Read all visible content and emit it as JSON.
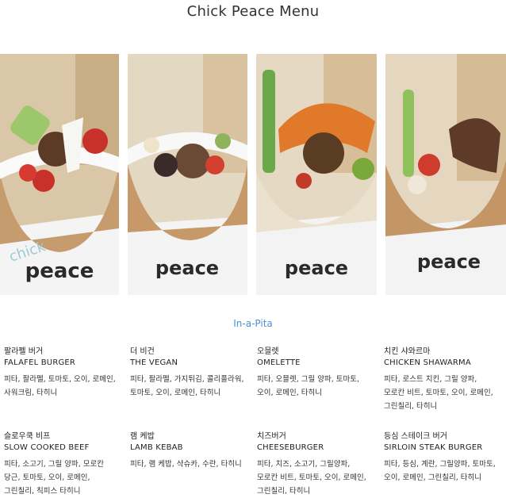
{
  "page": {
    "title": "Chick Peace Menu"
  },
  "photos": [
    {
      "name": "falafel-burger-photo",
      "box_text": "peace",
      "box_text2": "chick"
    },
    {
      "name": "the-vegan-photo",
      "box_text": "peace",
      "box_text2": ""
    },
    {
      "name": "omelette-photo",
      "box_text": "peace",
      "box_text2": ""
    },
    {
      "name": "chicken-shawarma-photo",
      "box_text": "peace",
      "box_text2": ""
    }
  ],
  "section": {
    "label": "In-a-Pita"
  },
  "menu": [
    {
      "ko": "팔라펠 버거",
      "en": "FALAFEL BURGER",
      "desc": "피타, 팔라펠, 토마토, 오이, 로메인, 사워크림, 타히니"
    },
    {
      "ko": "더 비건",
      "en": "THE VEGAN",
      "desc": "피타, 팔라펠, 가지튀김, 콜리플라워, 토마토, 오이, 로메인, 타히니"
    },
    {
      "ko": "오믈렛",
      "en": "OMELETTE",
      "desc": "피타, 오믈렛, 그릴 양파, 토마토, 오이, 로메인, 타히니"
    },
    {
      "ko": "치킨 샤와르마",
      "en": "CHICKEN SHAWARMA",
      "desc": "피타, 로스트 치킨, 그릴 양파, 모로칸 비트, 토마토, 오이, 로메인, 그린칠리, 타히니"
    },
    {
      "ko": "슬로우쿡 비프",
      "en": "SLOW COOKED BEEF",
      "desc": "피타, 소고기, 그릴 양파, 모로칸 당근, 토마토, 오이, 로메인, 그린칠리, 칙피스 타히니"
    },
    {
      "ko": "램 케밥",
      "en": "LAMB KEBAB",
      "desc": "피타, 램 케밥, 샥슈카, 수란, 타히니"
    },
    {
      "ko": "치즈버거",
      "en": "CHEESEBURGER",
      "desc": "피타, 치즈, 소고기, 그릴양파, 모로칸 비트, 토마토, 오이, 로메인, 그린칠리, 타히니"
    },
    {
      "ko": "등심 스테이크 버거",
      "en": "SIRLOIN STEAK BURGER",
      "desc": "피타, 등심, 계란, 그릴양파, 토마토, 오이, 로메인, 그린칠리, 타히니"
    }
  ]
}
